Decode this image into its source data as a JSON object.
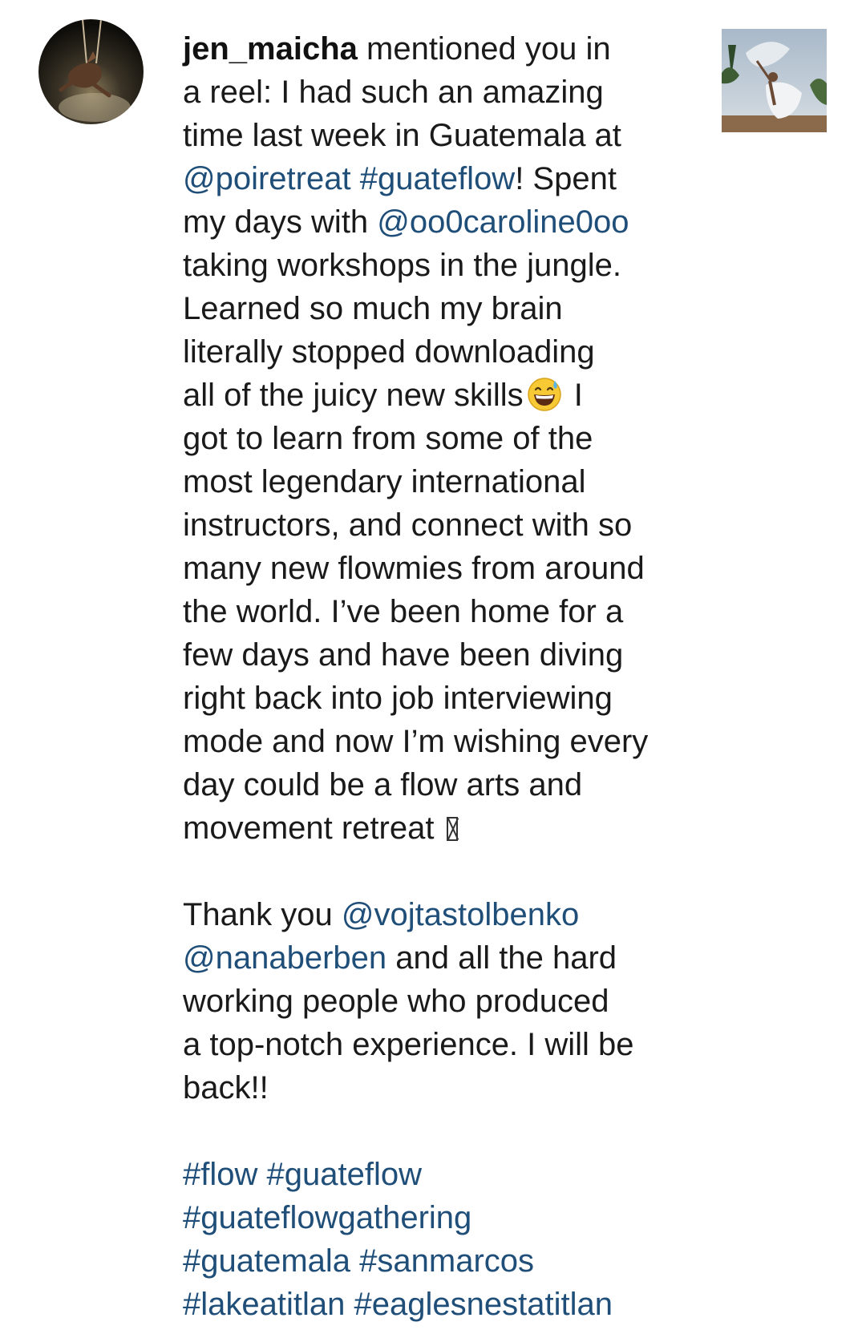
{
  "notification": {
    "username": "jen_maicha",
    "caption_lines": {
      "l1_rest": " mentioned you in",
      "l2": "a reel: I had such an amazing",
      "l3": "time last week in Guatemala at",
      "l4_link1": "@poiretreat",
      "l4_sp": " ",
      "l4_link2": "#guateflow",
      "l4_rest": "! Spent",
      "l5_text": "my days with ",
      "l5_link": "@oo0caroline0oo",
      "l6": "taking workshops in the jungle.",
      "l7": "Learned so much my brain",
      "l8": "literally stopped downloading",
      "l9_text": "all of the juicy new skills",
      "l9_rest": " I",
      "l10": "got to learn from some of the",
      "l11": "most legendary international",
      "l12": "instructors, and connect with so",
      "l13": "many new flowmies from around",
      "l14": "the world. I’ve been home for a",
      "l15": "few days and have been diving",
      "l16": "right back into job interviewing",
      "l17": "mode and now I’m wishing every",
      "l18": "day could be a flow arts and",
      "l19": "movement retreat ",
      "l21_text": "Thank you ",
      "l21_link": "@vojtastolbenko",
      "l22_link": "@nanaberben",
      "l22_rest": " and all the hard",
      "l23": "working people who produced",
      "l24": "a top-notch experience. I will be",
      "l25": "back!!",
      "l27_link1": "#flow",
      "l27_sp": " ",
      "l27_link2": "#guateflow",
      "l28_link": "#guateflowgathering",
      "l29_link1": "#guatemala",
      "l29_sp": " ",
      "l29_link2": "#sanmarcos",
      "l30_link1": "#lakeatitlan",
      "l30_sp": " ",
      "l30_link2": "#eaglesnestatitlan"
    },
    "emoji_icon": "grinning-face-with-sweat-icon",
    "missing_glyph_icon": "missing-glyph-icon"
  },
  "colors": {
    "link": "#1f4e79",
    "text": "#1a1a1a",
    "background": "#ffffff"
  }
}
